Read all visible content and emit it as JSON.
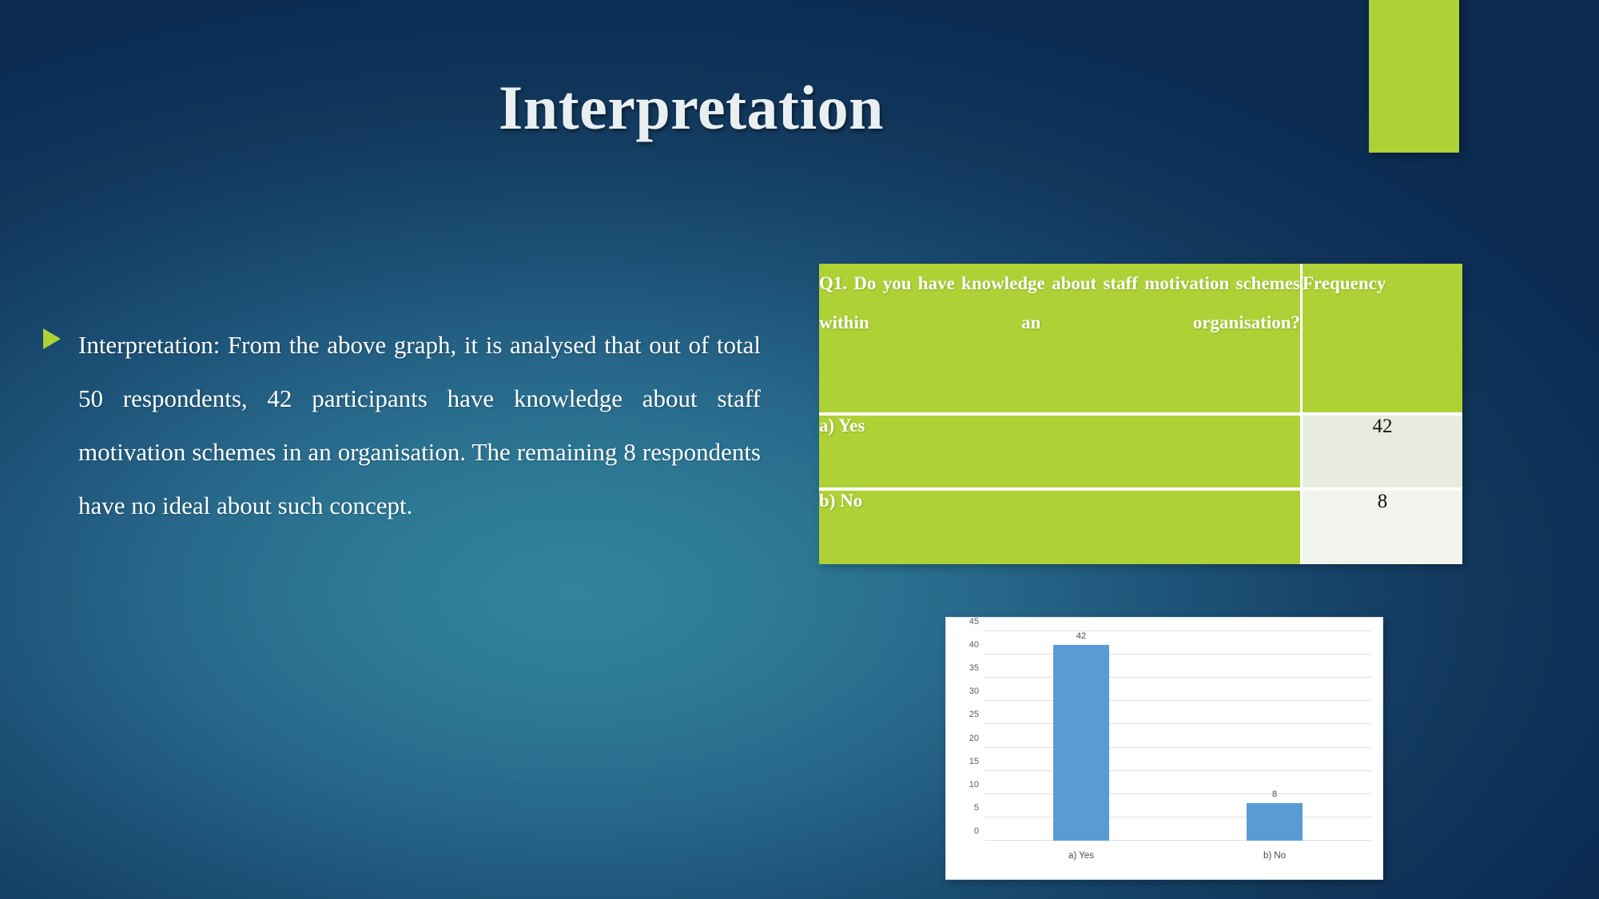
{
  "slide": {
    "title": "Interpretation",
    "accent_color": "#aed136",
    "background_dark": "#0b2a4f",
    "background_light": "#33839f"
  },
  "body": {
    "bullet_icon": "triangle-bullet-icon",
    "text": "Interpretation: From the above graph, it is analysed that out of total 50 respondents, 42 participants have knowledge about staff motivation schemes in an organisation. The remaining 8 respondents have no ideal about such concept."
  },
  "table": {
    "header": {
      "question": "Q1. Do you have knowledge about staff motivation schemes within an organisation?",
      "frequency": "Frequency"
    },
    "rows": [
      {
        "label": "a) Yes",
        "value": "42"
      },
      {
        "label": "b) No",
        "value": "8"
      }
    ]
  },
  "chart_data": {
    "type": "bar",
    "title": "",
    "xlabel": "",
    "ylabel": "",
    "categories": [
      "a) Yes",
      "b) No"
    ],
    "values": [
      42,
      8
    ],
    "data_labels": [
      "42",
      "8"
    ],
    "ylim": [
      0,
      45
    ],
    "yticks": [
      0,
      5,
      10,
      15,
      20,
      25,
      30,
      35,
      40,
      45
    ],
    "ytick_labels": [
      "0",
      "5",
      "10",
      "15",
      "20",
      "25",
      "30",
      "35",
      "40",
      "45"
    ],
    "grid": true,
    "legend": "none",
    "bar_color": "#5b9bd5",
    "plot_background": "#ffffff"
  }
}
